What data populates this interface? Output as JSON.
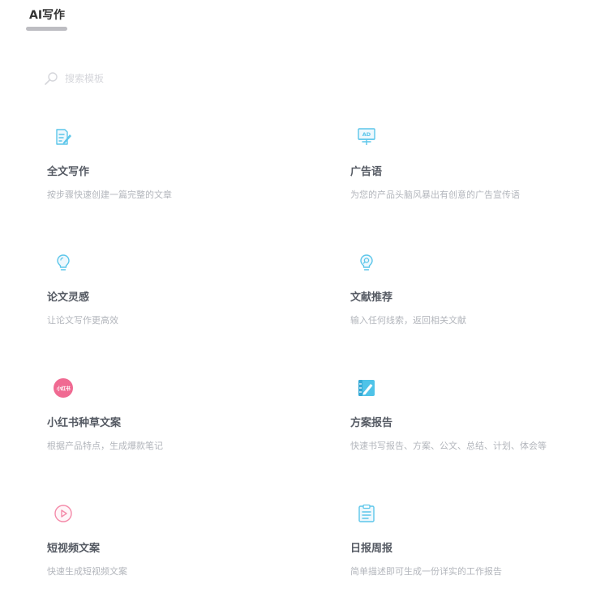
{
  "header": {
    "tab_label": "AI写作"
  },
  "search": {
    "placeholder": "搜索模板",
    "icon": "search-icon"
  },
  "colors": {
    "accent": "#5cc6ea",
    "pink": "#f06a92",
    "title": "#555a63",
    "desc": "#b3b6bc"
  },
  "templates": [
    {
      "title": "全文写作",
      "desc": "按步骤快速创建一篇完整的文章",
      "icon": "document-edit-icon"
    },
    {
      "title": "广告语",
      "desc": "为您的产品头脑风暴出有创意的广告宣传语",
      "icon": "ad-billboard-icon"
    },
    {
      "title": "论文灵感",
      "desc": "让论文写作更高效",
      "icon": "lightbulb-icon"
    },
    {
      "title": "文献推荐",
      "desc": "输入任何线索，返回相关文献",
      "icon": "search-bulb-icon"
    },
    {
      "title": "小红书种草文案",
      "desc": "根据产品特点，生成爆款笔记",
      "icon": "xiaohongshu-logo-icon",
      "logo_text": "小红书"
    },
    {
      "title": "方案报告",
      "desc": "快速书写报告、方案、公文、总结、计划、体会等",
      "icon": "notebook-pen-icon"
    },
    {
      "title": "短视频文案",
      "desc": "快速生成短视频文案",
      "icon": "play-circle-icon"
    },
    {
      "title": "日报周报",
      "desc": "简单描述即可生成一份详实的工作报告",
      "icon": "clipboard-report-icon"
    }
  ]
}
